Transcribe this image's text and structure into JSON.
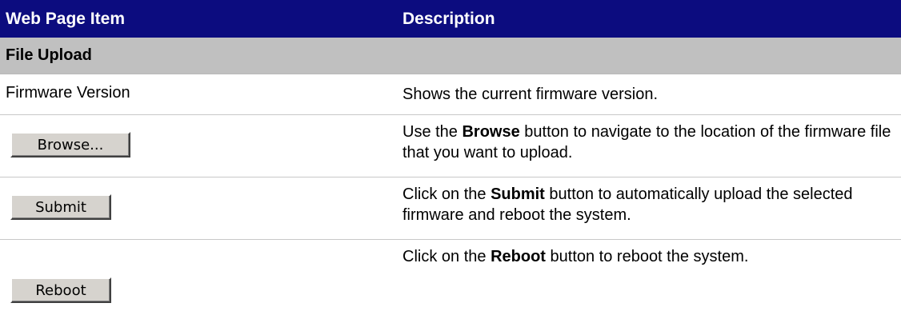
{
  "header": {
    "col1": "Web Page Item",
    "col2": "Description"
  },
  "section": {
    "title": "File Upload"
  },
  "rows": [
    {
      "item": "Firmware Version",
      "description": "Shows the current firmware version."
    },
    {
      "button_label": "Browse...",
      "desc_pre": "Use the ",
      "desc_bold": "Browse",
      "desc_post": " button to navigate to the location of the firmware file that you want to upload."
    },
    {
      "button_label": "Submit",
      "desc_pre": "Click on the ",
      "desc_bold": "Submit",
      "desc_post": " button to automatically upload the selected firmware and reboot the system."
    },
    {
      "button_label": "Reboot",
      "desc_pre": "Click on the ",
      "desc_bold": "Reboot",
      "desc_post": " button to reboot the system."
    }
  ]
}
